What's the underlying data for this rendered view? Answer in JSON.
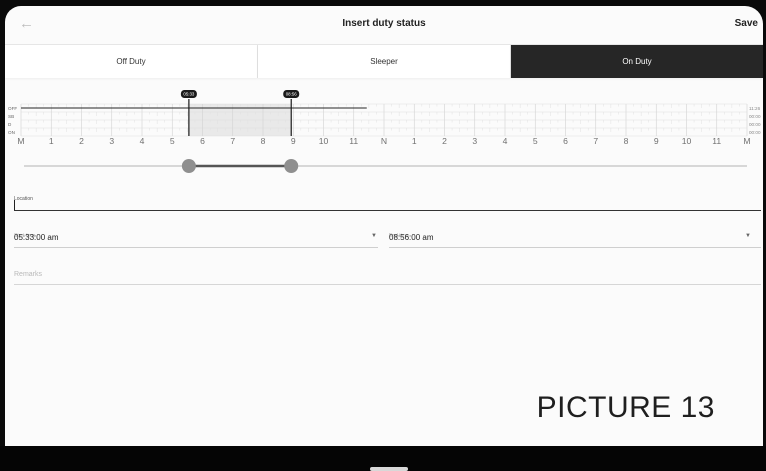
{
  "header": {
    "title": "Insert duty status",
    "save_label": "Save"
  },
  "tabs": [
    {
      "label": "Off Duty",
      "active": false
    },
    {
      "label": "Sleeper",
      "active": false
    },
    {
      "label": "On Duty",
      "active": true
    }
  ],
  "timeline": {
    "row_labels": [
      "OFF",
      "SB",
      "D",
      "ON"
    ],
    "row_totals": [
      "11:26",
      "00:00",
      "00:00",
      "00:00"
    ],
    "hour_labels": [
      "M",
      "1",
      "2",
      "3",
      "4",
      "5",
      "6",
      "7",
      "8",
      "9",
      "10",
      "11",
      "N",
      "1",
      "2",
      "3",
      "4",
      "5",
      "6",
      "7",
      "8",
      "9",
      "10",
      "11",
      "M"
    ],
    "off_duty_until_hour": 11.43,
    "selection_start_tag": "05:33",
    "selection_end_tag": "08:56",
    "selection_start_hour": 5.55,
    "selection_end_hour": 8.933,
    "active_color": "#262626",
    "selection_color": "#e9e9e9",
    "slider_color": "#8f8f8f"
  },
  "location": {
    "label": "Location",
    "value": ""
  },
  "start_time": {
    "label": "Start time",
    "value": "05:33:00 am"
  },
  "end_time": {
    "label": "End time",
    "value": "08:56:00 am"
  },
  "remarks": {
    "placeholder": "Remarks"
  },
  "overlay_caption": "PICTURE 13",
  "icons": {
    "back": "arrow-left-icon",
    "dropdown": "caret-down-icon"
  }
}
